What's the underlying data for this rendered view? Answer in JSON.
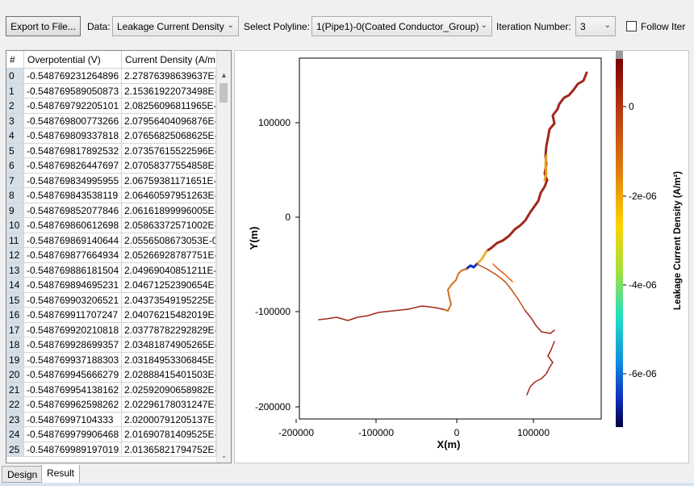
{
  "toolbar": {
    "export_label": "Export to File...",
    "data_label": "Data:",
    "data_value": "Leakage Current Density",
    "polyline_label": "Select Polyline:",
    "polyline_value": "1(Pipe1)-0(Coated Conductor_Group)",
    "iteration_label": "Iteration Number:",
    "iteration_value": "3",
    "follow_label": "Follow Iter",
    "follow_checked": false
  },
  "table": {
    "columns": [
      "#",
      "Overpotential (V)",
      "Current Density (A/m"
    ],
    "rows": [
      [
        "0",
        "-0.548769231264896",
        "2.27876398639637E-"
      ],
      [
        "1",
        "-0.548769589050873",
        "2.15361922073498E-"
      ],
      [
        "2",
        "-0.548769792205101",
        "2.08256096811965E-"
      ],
      [
        "3",
        "-0.548769800773266",
        "2.07956404096876E-"
      ],
      [
        "4",
        "-0.548769809337818",
        "2.07656825068625E-"
      ],
      [
        "5",
        "-0.548769817892532",
        "2.07357615522596E-"
      ],
      [
        "6",
        "-0.548769826447697",
        "2.07058377554858E-"
      ],
      [
        "7",
        "-0.548769834995955",
        "2.06759381171651E-"
      ],
      [
        "8",
        "-0.548769843538119",
        "2.06460597951263E-"
      ],
      [
        "9",
        "-0.548769852077846",
        "2.06161899996005E-"
      ],
      [
        "10",
        "-0.548769860612698",
        "2.05863372571002E-"
      ],
      [
        "11",
        "-0.548769869140644",
        "2.0556508673053E-0"
      ],
      [
        "12",
        "-0.548769877664934",
        "2.05266928787751E-"
      ],
      [
        "13",
        "-0.548769886181504",
        "2.04969040851211E-"
      ],
      [
        "14",
        "-0.548769894695231",
        "2.04671252390654E-"
      ],
      [
        "15",
        "-0.548769903206521",
        "2.04373549195225E-"
      ],
      [
        "16",
        "-0.548769911707247",
        "2.04076215482019E-"
      ],
      [
        "17",
        "-0.548769920210818",
        "2.03778782292829E-"
      ],
      [
        "18",
        "-0.548769928699357",
        "2.03481874905265E-"
      ],
      [
        "19",
        "-0.548769937188303",
        "2.03184953306845E-"
      ],
      [
        "20",
        "-0.548769945666279",
        "2.02888415401503E-"
      ],
      [
        "21",
        "-0.548769954138162",
        "2.02592090658982E-"
      ],
      [
        "22",
        "-0.548769962598262",
        "2.02296178031247E-"
      ],
      [
        "23",
        "-0.54876997104333",
        "2.02000791205137E-"
      ],
      [
        "24",
        "-0.548769979906468",
        "2.01690781409525E-"
      ],
      [
        "25",
        "-0.548769989197019",
        "2.01365821794752E-"
      ]
    ]
  },
  "plot": {
    "xlabel": "X(m)",
    "ylabel": "Y(m)",
    "x_ticks": [
      "-200000",
      "-100000",
      "0",
      "100000"
    ],
    "y_ticks": [
      "100000",
      "0",
      "-100000",
      "-200000"
    ],
    "colorbar_label": "Leakage Current Density (A/m²)",
    "colorbar_ticks": [
      "0",
      "-2e-06",
      "-4e-06",
      "-6e-06"
    ],
    "colors": {
      "high": "#a0281a",
      "mid": "#ffd200",
      "low": "#0000a0"
    }
  },
  "tabs": [
    "Design",
    "Result"
  ]
}
